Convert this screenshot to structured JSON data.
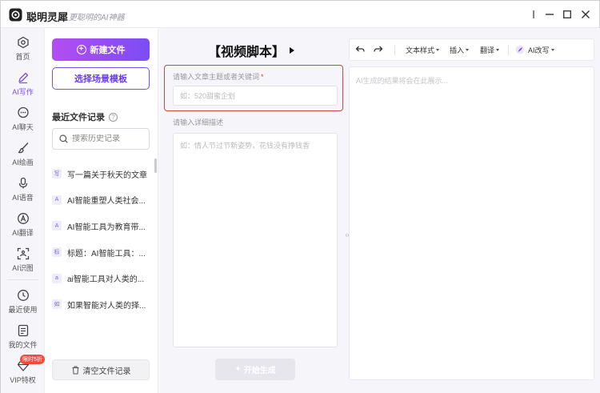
{
  "app": {
    "name": "聪明灵犀",
    "slogan": "更聪明的AI神器"
  },
  "nav": {
    "items": [
      {
        "label": "首页"
      },
      {
        "label": "AI写作"
      },
      {
        "label": "AI聊天"
      },
      {
        "label": "AI绘画"
      },
      {
        "label": "AI语音"
      },
      {
        "label": "AI翻译"
      },
      {
        "label": "AI识图"
      },
      {
        "label": "最近使用"
      },
      {
        "label": "我的文件"
      },
      {
        "label": "VIP特权"
      }
    ],
    "vip_badge": "限时5折"
  },
  "files": {
    "new_button": "新建文件",
    "template_button": "选择场景模板",
    "recent_title": "最近文件记录",
    "search_placeholder": "搜索历史记录",
    "items": [
      {
        "badge": "写",
        "name": "写一篇关于秋天的文章"
      },
      {
        "badge": "A",
        "name": "AI智能重塑人类社会..."
      },
      {
        "badge": "A",
        "name": "AI智能工具为教育带..."
      },
      {
        "badge": "标",
        "name": "标题：AI智能工具：..."
      },
      {
        "badge": "a",
        "name": "ai智能工具对人类的..."
      },
      {
        "badge": "如",
        "name": "如果智能对人类的择..."
      }
    ],
    "clear_button": "清空文件记录"
  },
  "editor": {
    "title": "【视频脚本】",
    "topic_label": "请输入文章主题或者关键词",
    "topic_required": "*",
    "topic_placeholder": "如：520甜蜜企划",
    "desc_label": "请输入详细描述",
    "desc_placeholder": "如：情人节过节新姿势，花钱没有挣钱香",
    "generate_button": "开始生成"
  },
  "result": {
    "toolbar": {
      "text_style": "文本样式",
      "insert": "插入",
      "translate": "翻译",
      "ai_rewrite": "AI改写"
    },
    "placeholder": "AI生成的结果将会在此展示..."
  },
  "colors": {
    "accent": "#7a4df5",
    "accent_gradient_start": "#b44df2",
    "highlight_border": "#c8493e",
    "badge_red": "#ef4d3b"
  }
}
